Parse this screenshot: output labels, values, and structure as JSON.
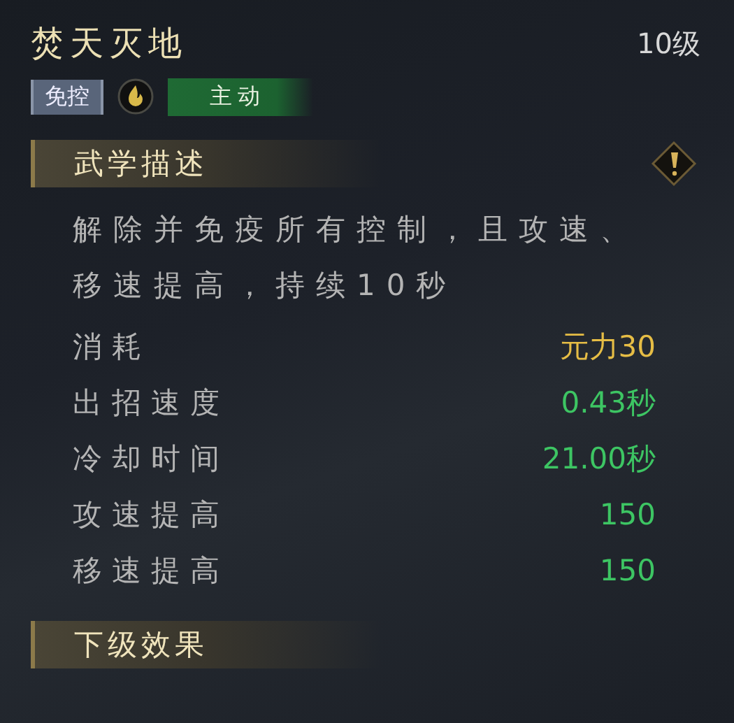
{
  "skill": {
    "name": "焚天灭地",
    "level": "10级"
  },
  "tags": [
    {
      "kind": "label",
      "text": "免控"
    },
    {
      "kind": "icon"
    },
    {
      "kind": "brush",
      "text": "主动"
    }
  ],
  "sections": [
    {
      "title": "武学描述",
      "info_icon": true,
      "description": "解除并免疫所有控制，且攻速、移速提高，持续10秒",
      "stats": [
        {
          "label": "消耗",
          "value": "元力30",
          "color": "#e6bd45"
        },
        {
          "label": "出招速度",
          "value": "0.43秒",
          "color": "#3dc563"
        },
        {
          "label": "冷却时间",
          "value": "21.00秒",
          "color": "#3dc563"
        },
        {
          "label": "攻速提高",
          "value": "150",
          "color": "#3dc563"
        },
        {
          "label": "移速提高",
          "value": "150",
          "color": "#3dc563"
        }
      ]
    },
    {
      "title": "下级效果",
      "info_icon": false
    }
  ]
}
